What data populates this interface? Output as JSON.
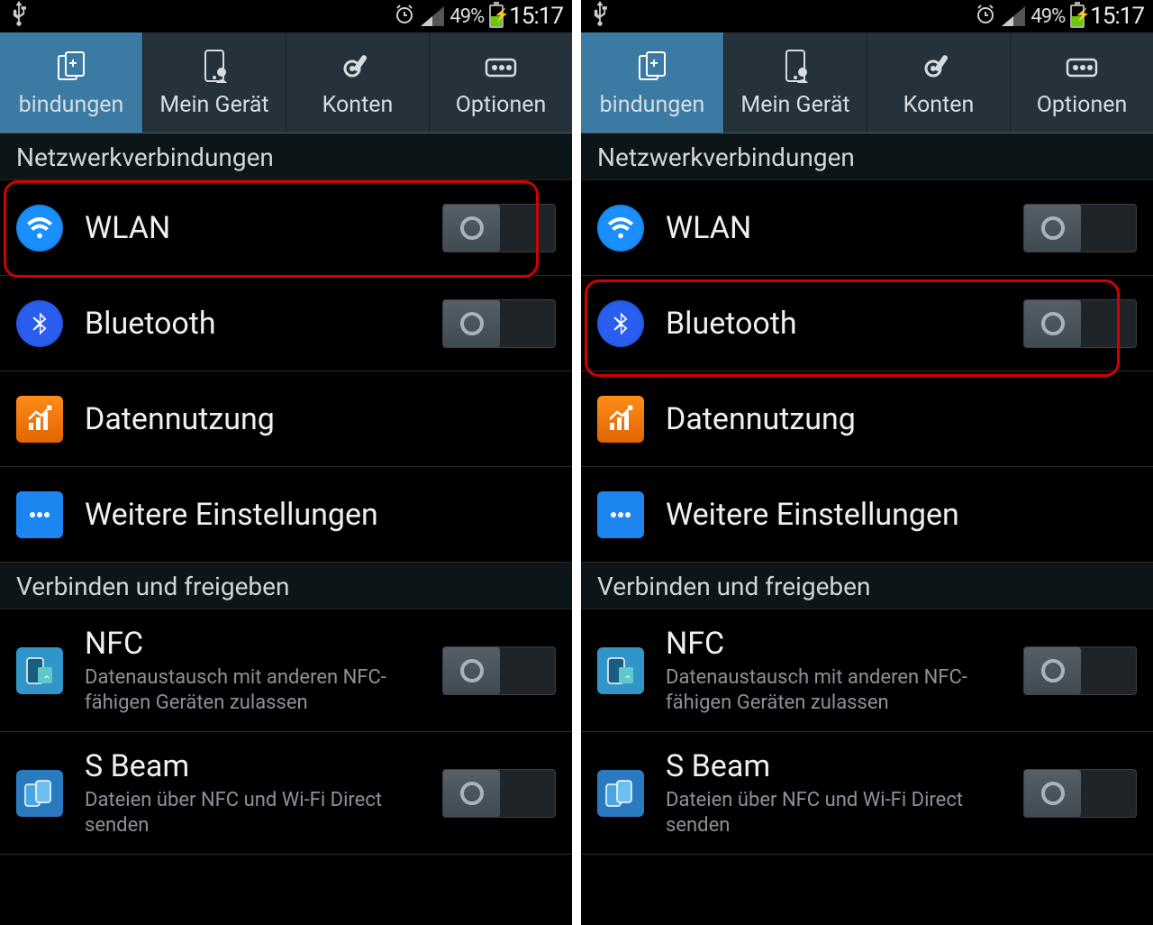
{
  "status": {
    "battery_pct": "49%",
    "time": "15:17"
  },
  "tabs": {
    "connections": "bindungen",
    "mydevice": "Mein Gerät",
    "accounts": "Konten",
    "options": "Optionen"
  },
  "sections": {
    "network": "Netzwerkverbindungen",
    "share": "Verbinden und freigeben"
  },
  "items": {
    "wlan": "WLAN",
    "bluetooth": "Bluetooth",
    "datausage": "Datennutzung",
    "moresettings": "Weitere Einstellungen",
    "nfc": {
      "title": "NFC",
      "sub": "Datenaustausch mit anderen NFC-fähigen Geräten zulassen"
    },
    "sbeam": {
      "title": "S Beam",
      "sub": "Dateien über NFC und Wi-Fi Direct senden"
    }
  },
  "highlight": {
    "left": "wlan",
    "right": "bluetooth"
  }
}
